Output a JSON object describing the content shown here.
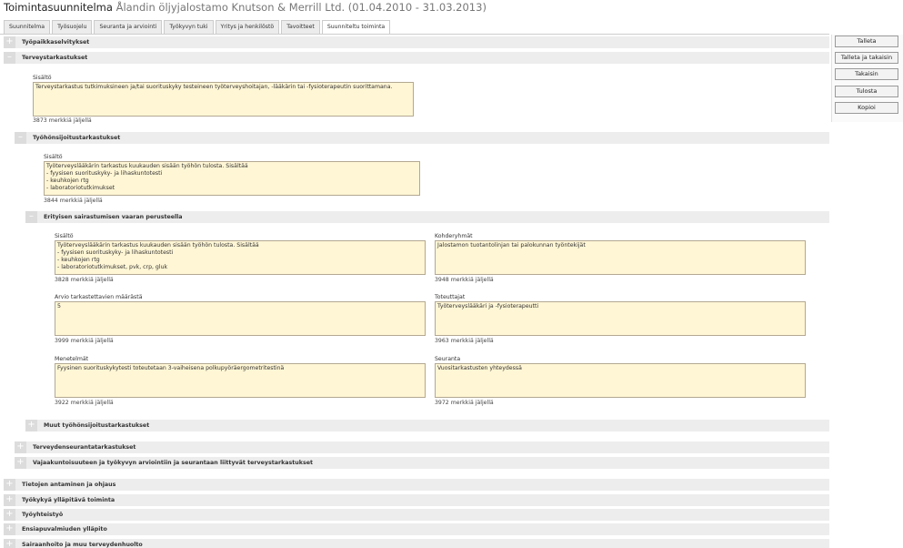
{
  "header": {
    "title": "Toimintasuunnitelma",
    "subtitle": "Ålandin öljyjalostamo Knutson & Merrill Ltd. (01.04.2010 - 31.03.2013)"
  },
  "tabs": [
    {
      "label": "Suunnitelma",
      "active": false
    },
    {
      "label": "Työsuojelu",
      "active": false
    },
    {
      "label": "Seuranta ja arviointi",
      "active": false
    },
    {
      "label": "Työkyvyn tuki",
      "active": false
    },
    {
      "label": "Yritys ja henkilöstö",
      "active": false
    },
    {
      "label": "Tavoitteet",
      "active": false
    },
    {
      "label": "Suunniteltu toiminta",
      "active": true
    }
  ],
  "actions": {
    "save": "Talleta",
    "save_back": "Talleta ja takaisin",
    "back": "Takaisin",
    "print": "Tulosta",
    "copy": "Kopioi"
  },
  "sections": {
    "workplace_surveys": "Työpaikkaselvitykset",
    "health_checks": "Terveystarkastukset",
    "placement_checks": "Työhönsijoitustarkastukset",
    "special_risk": "Erityisen sairastumisen vaaran perusteella",
    "other_placement": "Muut työhönsijoitustarkastukset",
    "health_monitoring": "Terveydenseurantatarkastukset",
    "reduced_capacity": "Vajaakuntoisuuteen ja työkyvyn arviointiin ja seurantaan liittyvät terveystarkastukset",
    "info_guidance": "Tietojen antaminen ja ohjaus",
    "capacity_maintenance": "Työkykyä ylläpitävä toiminta",
    "cooperation": "Työyhteistyö",
    "first_aid": "Ensiapuvalmiuden ylläpito",
    "medical_care": "Sairaanhoito ja muu terveydenhuolto"
  },
  "health_checks": {
    "content_label": "Sisältö",
    "content_value": "Terveystarkastus tutkimuksineen ja/tai suorituskyky testeineen työterveyshoitajan, -lääkärin tai -fysioterapeutin suorittamana.",
    "remaining": "3873 merkkiä jäljellä"
  },
  "placement": {
    "content_label": "Sisältö",
    "content_value": "Työterveyslääkärin tarkastus kuukauden sisään työhön tulosta. Sisältää\n- fyysisen suorituskyky- ja lihaskuntotesti\n- keuhkojen rtg\n- laboratoriotutkimukset",
    "remaining": "3844 merkkiä jäljellä"
  },
  "special": {
    "content_label": "Sisältö",
    "content_value": "Työterveyslääkärin tarkastus kuukauden sisään työhön tulosta. Sisältää\n- fyysisen suorituskyky- ja lihaskuntotesti\n- keuhkojen rtg\n- laboratoriotutkimukset, pvk, crp, gluk",
    "content_remaining": "3828 merkkiä jäljellä",
    "groups_label": "Kohderyhmät",
    "groups_value": "Jalostamon tuotantolinjan tai palokunnan työntekijät",
    "groups_remaining": "3948 merkkiä jäljellä",
    "count_label": "Arvio tarkastettavien määrästä",
    "count_value": "5",
    "count_remaining": "3999 merkkiä jäljellä",
    "executors_label": "Toteuttajat",
    "executors_value": "Työterveyslääkäri ja -fysioterapeutti",
    "executors_remaining": "3963 merkkiä jäljellä",
    "methods_label": "Menetelmät",
    "methods_value": "Fyysinen suorituskykytesti toteutetaan 3-vaiheisena polkupyöräergometritestinä",
    "methods_remaining": "3922 merkkiä jäljellä",
    "followup_label": "Seuranta",
    "followup_value": "Vuositarkastusten yhteydessä",
    "followup_remaining": "3972 merkkiä jäljellä"
  },
  "icons": {
    "expand": "plus-icon",
    "collapse": "minus-icon",
    "plus_glyph": "+",
    "minus_glyph": "–"
  },
  "colors": {
    "textarea_bg": "#fff6d5",
    "bar_bg": "#ededed"
  }
}
